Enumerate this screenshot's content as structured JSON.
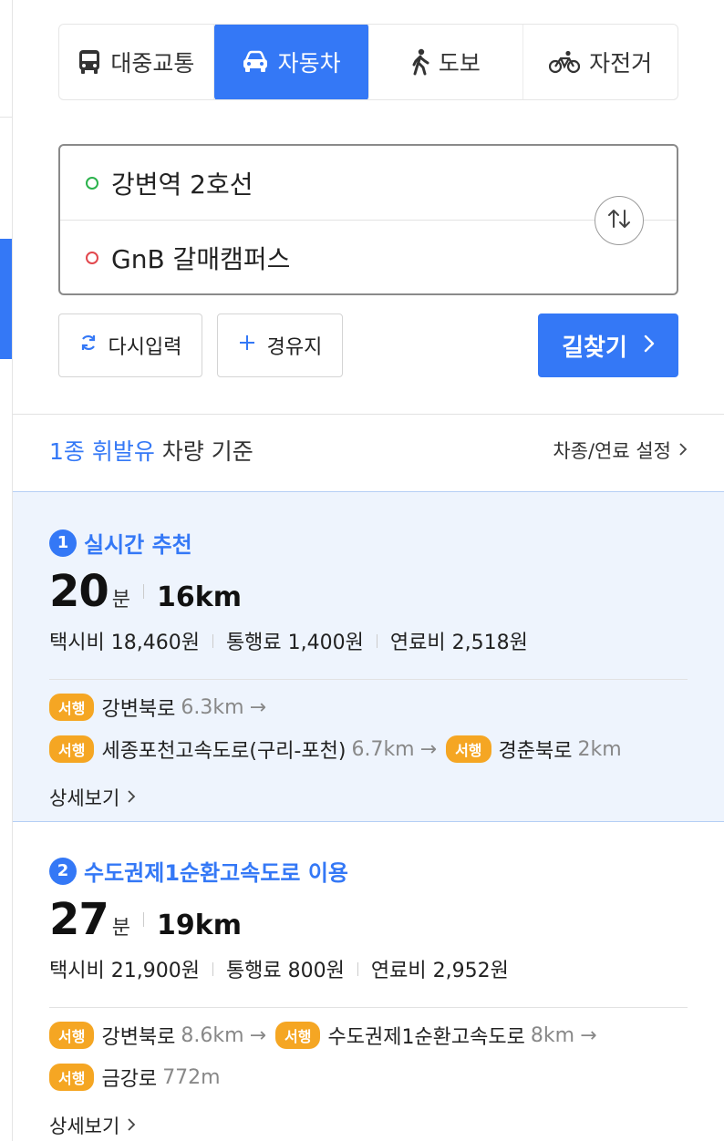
{
  "tabs": [
    {
      "label": "대중교통",
      "icon": "bus-icon",
      "active": false
    },
    {
      "label": "자동차",
      "icon": "car-icon",
      "active": true
    },
    {
      "label": "도보",
      "icon": "walk-icon",
      "active": false
    },
    {
      "label": "자전거",
      "icon": "bicycle-icon",
      "active": false
    }
  ],
  "route": {
    "origin": "강변역 2호선",
    "destination": "GnB 갈매캠퍼스"
  },
  "actions": {
    "reset_label": "다시입력",
    "via_label": "경유지",
    "search_label": "길찾기"
  },
  "vehicle": {
    "highlight": "1종 휘발유",
    "suffix": " 차량 기준",
    "settings_label": "차종/연료 설정"
  },
  "results": [
    {
      "rank": "1",
      "title": "실시간 추천",
      "minutes": "20",
      "minutes_unit": "분",
      "distance": "16km",
      "taxi": "택시비 18,460원",
      "toll": "통행료 1,400원",
      "fuel": "연료비 2,518원",
      "lines": [
        [
          {
            "tag": "서행",
            "road": "강변북로",
            "dist": "6.3km",
            "arrow": true
          }
        ],
        [
          {
            "tag": "서행",
            "road": "세종포천고속도로(구리-포천)",
            "dist": "6.7km",
            "arrow": true
          },
          {
            "tag": "서행",
            "road": "경춘북로",
            "dist": "2km",
            "arrow": false
          }
        ]
      ],
      "detail_label": "상세보기"
    },
    {
      "rank": "2",
      "title": "수도권제1순환고속도로 이용",
      "minutes": "27",
      "minutes_unit": "분",
      "distance": "19km",
      "taxi": "택시비 21,900원",
      "toll": "통행료 800원",
      "fuel": "연료비 2,952원",
      "lines": [
        [
          {
            "tag": "서행",
            "road": "강변북로",
            "dist": "8.6km",
            "arrow": true
          },
          {
            "tag": "서행",
            "road": "수도권제1순환고속도로",
            "dist": "8km",
            "arrow": true
          }
        ],
        [
          {
            "tag": "서행",
            "road": "금강로",
            "dist": "772m",
            "arrow": false
          }
        ]
      ],
      "detail_label": "상세보기"
    }
  ],
  "colors": {
    "accent": "#3478f6",
    "slow_tag": "#f5a623",
    "origin_dot": "#2bb24c",
    "dest_dot": "#e2474d"
  }
}
